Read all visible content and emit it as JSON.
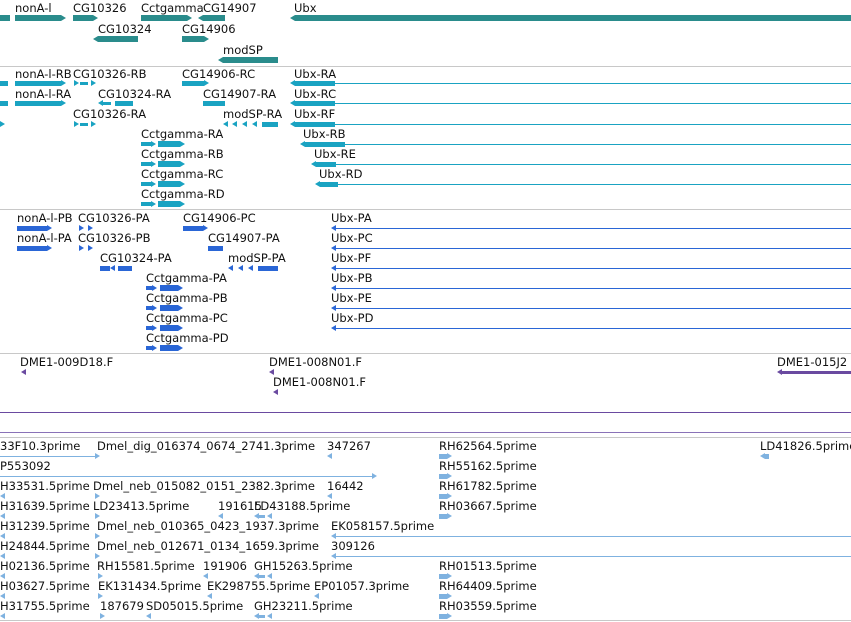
{
  "colors": {
    "gene": "#2a8c8c",
    "transcript": "#1aa3c2",
    "protein": "#2a66d6",
    "cdna": "#6a4aa0",
    "est": "#7fb2e0",
    "separator": "#c8c8c8"
  },
  "tracks": {
    "genes": {
      "labels": [
        "nonA-l",
        "CG10326",
        "Cctgamma",
        "CG14907",
        "Ubx",
        "CG10324",
        "CG14906",
        "modSP"
      ]
    },
    "transcripts": {
      "labels": [
        "nonA-l-RB",
        "CG10326-RB",
        "CG14906-RC",
        "Ubx-RA",
        "nonA-l-RA",
        "CG10324-RA",
        "CG14907-RA",
        "Ubx-RC",
        "CG10326-RA",
        "modSP-RA",
        "Ubx-RF",
        "Cctgamma-RA",
        "Ubx-RB",
        "Cctgamma-RB",
        "Ubx-RE",
        "Cctgamma-RC",
        "Ubx-RD",
        "Cctgamma-RD"
      ]
    },
    "proteins": {
      "labels": [
        "nonA-l-PB",
        "CG10326-PA",
        "CG14906-PC",
        "Ubx-PA",
        "nonA-l-PA",
        "CG10326-PB",
        "CG14907-PA",
        "Ubx-PC",
        "CG10324-PA",
        "modSP-PA",
        "Ubx-PF",
        "Cctgamma-PA",
        "Ubx-PB",
        "Cctgamma-PB",
        "Ubx-PE",
        "Cctgamma-PC",
        "Ubx-PD",
        "Cctgamma-PD"
      ]
    },
    "cdna": {
      "labels": [
        "DME1-009D18.F",
        "DME1-008N01.F",
        "DME1-015J2",
        "DME1-008N01.F"
      ]
    },
    "est": {
      "labels": [
        "33F10.3prime",
        "Dmel_dig_016374_0674_2741.3prime",
        "347267",
        "RH62564.5prime",
        "LD41826.5prime",
        "P553092",
        "RH55162.5prime",
        "H33531.5prime",
        "Dmel_neb_015082_0151_2382.3prime",
        "16442",
        "RH61782.5prime",
        "H31639.5prime",
        "LD23413.5prime",
        "191615",
        "LD43188.5prime",
        "RH03667.5prime",
        "H31239.5prime",
        "Dmel_neb_010365_0423_1937.3prime",
        "EK058157.5prime",
        "H24844.5prime",
        "Dmel_neb_012671_0134_1659.3prime",
        "309126",
        "H02136.5prime",
        "RH15581.5prime",
        "191906",
        "GH15263.5prime",
        "RH01513.5prime",
        "H03627.5prime",
        "EK131434.5prime",
        "EK298755.5prime",
        "EP01057.3prime",
        "RH64409.5prime",
        "H31755.5prime",
        "187679",
        "SD05015.5prime",
        "GH23211.5prime",
        "RH03559.5prime"
      ]
    }
  }
}
